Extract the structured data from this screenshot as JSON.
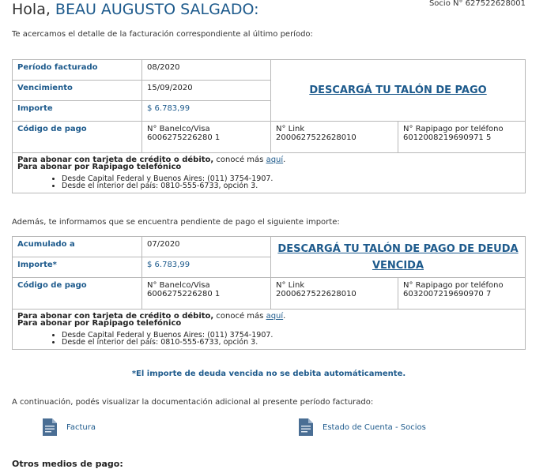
{
  "greeting": {
    "hola": "Hola,",
    "name": "BEAU AUGUSTO SALGADO:"
  },
  "socio": "Socio N° 627522628001",
  "intro": "Te acercamos el detalle de la facturación correspondiente al último período:",
  "bill1": {
    "periodo_label": "Período facturado",
    "periodo_value": "08/2020",
    "venc_label": "Vencimiento",
    "venc_value": "15/09/2020",
    "importe_label": "Importe",
    "importe_value": "$ 6.783,99",
    "download_link": "DESCARGÁ TU TALÓN DE PAGO",
    "codigo_label": "Código de pago",
    "banelco_label": "N° Banelco/Visa",
    "banelco_value": "6006275226280 1",
    "link_label": "N° Link",
    "link_value": "2000627522628010",
    "rapi_label": "N° Rapipago por teléfono",
    "rapi_value": "6012008219690971 5"
  },
  "note1": {
    "card_bold": "Para abonar con tarjeta de crédito o débito,",
    "card_rest": " conocé más ",
    "card_link": "aquí",
    "card_end": ".",
    "rapi_bold": "Para abonar por Rapipago telefónico",
    "items": [
      "Desde Capital Federal y Buenos Aires: (011) 3754-1907.",
      "Desde el interior del país: 0810-555-6733, opción 3."
    ]
  },
  "intro2": "Además, te informamos que se encuentra pendiente de pago el siguiente importe:",
  "bill2": {
    "acum_label": "Acumulado a",
    "acum_value": "07/2020",
    "importe_label": "Importe*",
    "importe_value": "$ 6.783,99",
    "download_link": "DESCARGÁ TU TALÓN DE PAGO DE DEUDA VENCIDA",
    "codigo_label": "Código de pago",
    "banelco_label": "N° Banelco/Visa",
    "banelco_value": "6006275226280 1",
    "link_label": "N° Link",
    "link_value": "2000627522628010",
    "rapi_label": "N° Rapipago por teléfono",
    "rapi_value": "6032007219690970 7"
  },
  "note2": {
    "card_bold": "Para abonar con tarjeta de crédito o débito,",
    "card_rest": " conocé más ",
    "card_link": "aquí",
    "card_end": ".",
    "rapi_bold": "Para abonar por Rapipago telefónico",
    "items": [
      "Desde Capital Federal y Buenos Aires: (011) 3754-1907.",
      "Desde el interior del país: 0810-555-6733, opción 3."
    ]
  },
  "warning": "*El importe de deuda vencida no se debita automáticamente.",
  "intro3": "A continuación, podés visualizar la documentación adicional al presente período facturado:",
  "docs": [
    {
      "label": "Factura",
      "icon": "document-icon"
    },
    {
      "label": "Estado de Cuenta - Socios",
      "icon": "document-icon"
    }
  ],
  "others": "Otros medios de pago:",
  "colors": {
    "accent": "#1d5a8c",
    "border": "#b8b8b8"
  }
}
